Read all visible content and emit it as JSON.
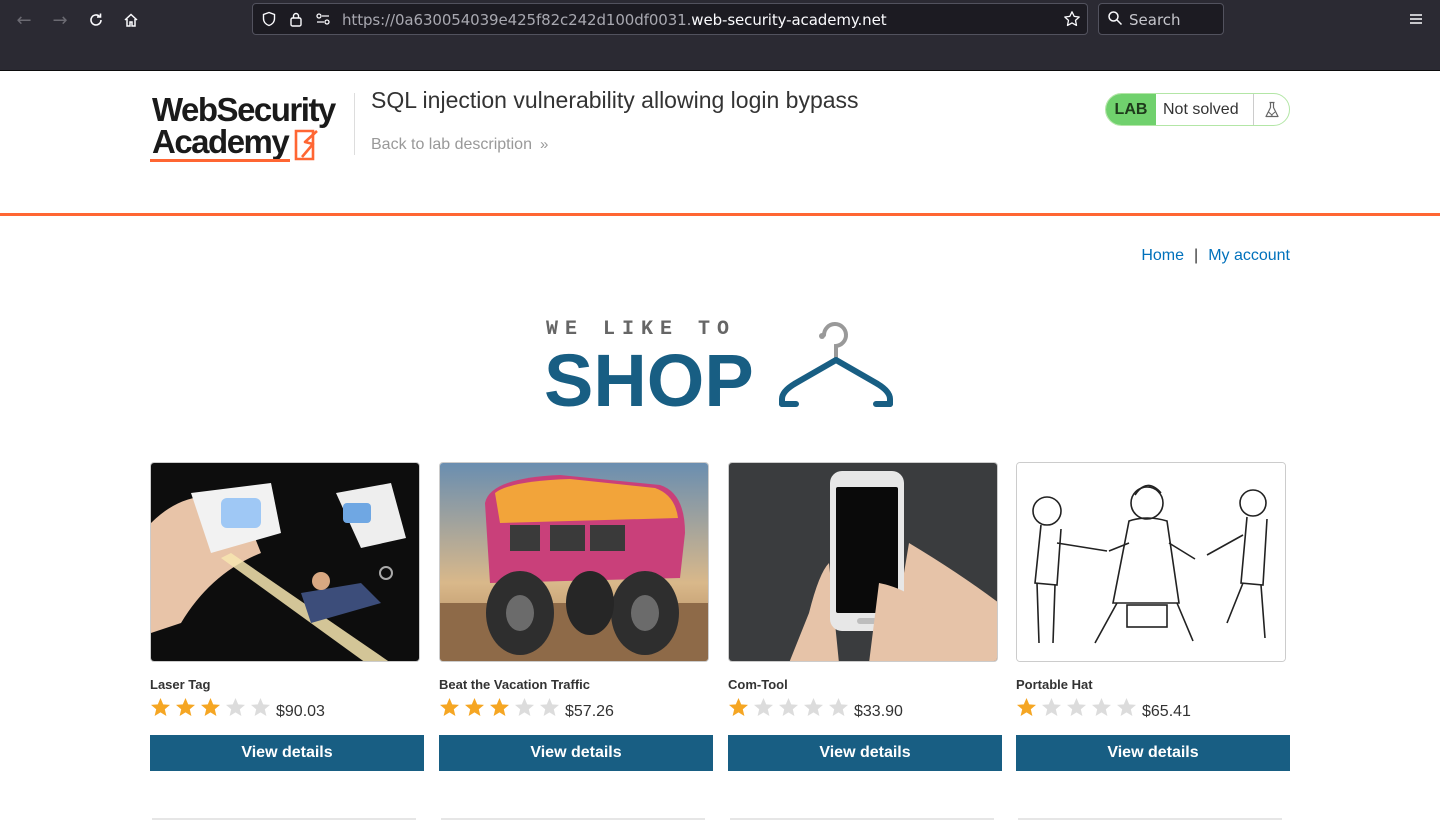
{
  "browser": {
    "url_prefix": "https://0a630054039e425f82c242d100df0031.",
    "url_domain": "web-security-academy.net",
    "search_placeholder": "Search",
    "icons": [
      "back-icon",
      "forward-icon",
      "reload-icon",
      "home-icon",
      "shield-icon",
      "lock-icon",
      "permissions-icon",
      "bookmark-star-icon",
      "search-icon",
      "hamburger-menu-icon"
    ]
  },
  "lab": {
    "logo_line1": "WebSecurity",
    "logo_line2": "Academy",
    "title": "SQL injection vulnerability allowing login bypass",
    "back_link": "Back to lab description",
    "back_chevron": "»",
    "badge": "LAB",
    "status": "Not solved",
    "accent_color": "#ff6633",
    "solved_badge_color": "#70d16d"
  },
  "nav": {
    "home": "Home",
    "separator": "|",
    "account": "My account"
  },
  "banner": {
    "line1": "WE LIKE TO",
    "line2": "SHOP",
    "color": "#185e83"
  },
  "products": [
    {
      "name": "Laser Tag",
      "rating": 3,
      "max_rating": 5,
      "price": "$90.03",
      "button": "View details"
    },
    {
      "name": "Beat the Vacation Traffic",
      "rating": 3,
      "max_rating": 5,
      "price": "$57.26",
      "button": "View details"
    },
    {
      "name": "Com-Tool",
      "rating": 1,
      "max_rating": 5,
      "price": "$33.90",
      "button": "View details"
    },
    {
      "name": "Portable Hat",
      "rating": 1,
      "max_rating": 5,
      "price": "$65.41",
      "button": "View details"
    }
  ],
  "colors": {
    "button_bg": "#185e83",
    "link": "#0071bc",
    "star_filled": "#f5a623",
    "star_empty": "#dcdcdc"
  }
}
